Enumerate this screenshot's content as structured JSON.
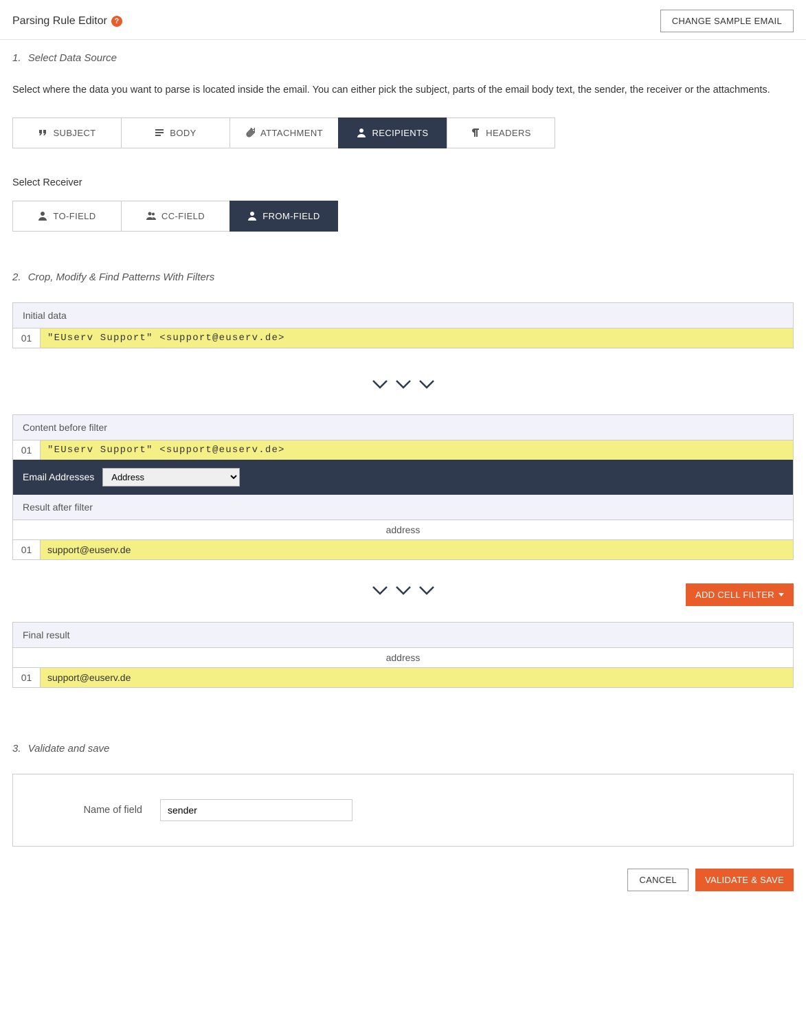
{
  "header": {
    "title": "Parsing Rule Editor",
    "help_icon": "?",
    "change_sample_btn": "CHANGE SAMPLE EMAIL"
  },
  "step1": {
    "num": "1.",
    "title": "Select Data Source",
    "description": "Select where the data you want to parse is located inside the email. You can either pick the subject, parts of the email body text, the sender, the receiver or the attachments.",
    "tabs": [
      {
        "label": "SUBJECT",
        "icon": "quote"
      },
      {
        "label": "BODY",
        "icon": "lines"
      },
      {
        "label": "ATTACHMENT",
        "icon": "paperclip"
      },
      {
        "label": "RECIPIENTS",
        "icon": "user",
        "active": true
      },
      {
        "label": "HEADERS",
        "icon": "pilcrow"
      }
    ],
    "receiver_label": "Select Receiver",
    "receiver_tabs": [
      {
        "label": "TO-FIELD",
        "icon": "user"
      },
      {
        "label": "CC-FIELD",
        "icon": "users"
      },
      {
        "label": "FROM-FIELD",
        "icon": "user",
        "active": true
      }
    ]
  },
  "step2": {
    "num": "2.",
    "title": "Crop, Modify & Find Patterns With Filters",
    "initial_data_label": "Initial data",
    "initial_row_num": "01",
    "initial_row_val": "\"EUserv Support\" <support@euserv.de>",
    "before_label": "Content before filter",
    "before_row_num": "01",
    "before_row_val": "\"EUserv Support\" <support@euserv.de>",
    "filter_name": "Email Addresses",
    "filter_select_value": "Address",
    "after_label": "Result after filter",
    "col_header": "address",
    "after_row_num": "01",
    "after_row_val": "support@euserv.de",
    "add_filter_btn": "ADD CELL FILTER",
    "final_label": "Final result",
    "final_col_header": "address",
    "final_row_num": "01",
    "final_row_val": "support@euserv.de"
  },
  "step3": {
    "num": "3.",
    "title": "Validate and save",
    "field_label": "Name of field",
    "field_value": "sender"
  },
  "footer": {
    "cancel": "CANCEL",
    "save": "VALIDATE & SAVE"
  }
}
